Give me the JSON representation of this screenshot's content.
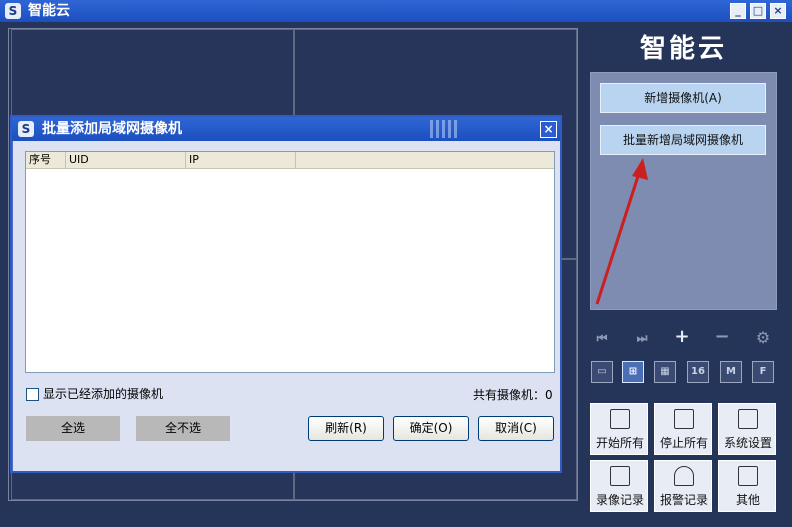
{
  "window": {
    "title": "智能云",
    "logo_glyph": "S",
    "minimize": "_",
    "maximize": "□",
    "close": "×"
  },
  "sidebar": {
    "brand": "智能云",
    "add_camera": "新增摄像机(A)",
    "batch_add_lan_camera": "批量新增局域网摄像机",
    "controls": {
      "first": "⏮",
      "next": "⏭",
      "add": "+",
      "remove": "−",
      "settings": "⚙"
    },
    "layouts": [
      "▭",
      "⊞",
      "▦",
      "16",
      "M",
      "F"
    ],
    "tiles": [
      "开始所有",
      "停止所有",
      "系统设置",
      "录像记录",
      "报警记录",
      "其他"
    ]
  },
  "dialog": {
    "title": "批量添加局域网摄像机",
    "logo_glyph": "S",
    "close": "×",
    "columns": [
      "序号",
      "UID",
      "IP",
      ""
    ],
    "rows": [],
    "show_added_label": "显示已经添加的摄像机",
    "show_added_checked": false,
    "count_label": "共有摄像机：0",
    "select_all": "全选",
    "select_none": "全不选",
    "refresh": "刷新(R)",
    "ok": "确定(O)",
    "cancel": "取消(C)"
  },
  "colors": {
    "accent": "#2f66d4",
    "annotation_arrow": "#cc1f1f",
    "panel": "#7d8cb0",
    "button_light": "#b8d4f0"
  }
}
